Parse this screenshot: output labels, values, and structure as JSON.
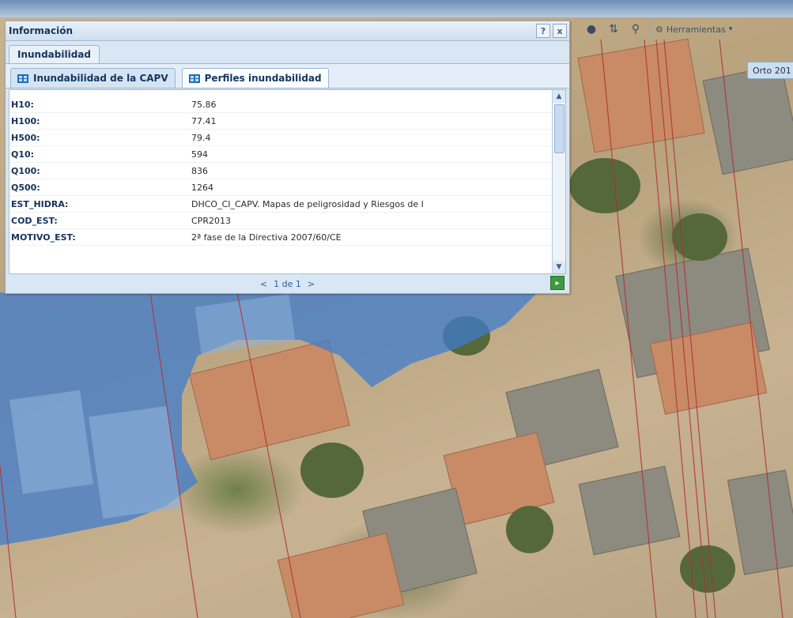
{
  "panel": {
    "title": "Información",
    "help_label": "?",
    "close_label": "x",
    "main_tab": "Inundabilidad",
    "sub_tabs": [
      {
        "label": "Inundabilidad de la CAPV",
        "active": false
      },
      {
        "label": "Perfiles inundabilidad",
        "active": true
      }
    ],
    "rows": [
      {
        "key": "H10:",
        "value": "75.86"
      },
      {
        "key": "H100:",
        "value": "77.41"
      },
      {
        "key": "H500:",
        "value": "79.4"
      },
      {
        "key": "Q10:",
        "value": "594"
      },
      {
        "key": "Q100:",
        "value": "836"
      },
      {
        "key": "Q500:",
        "value": "1264"
      },
      {
        "key": "EST_HIDRA:",
        "value": "DHCO_CI_CAPV. Mapas de peligrosidad y Riesgos de I"
      },
      {
        "key": "COD_EST:",
        "value": "CPR2013"
      },
      {
        "key": "MOTIVO_EST:",
        "value": "2ª fase de la Directiva 2007/60/CE"
      }
    ],
    "pager": {
      "prev": "<",
      "page_text": "1 de 1",
      "next": ">"
    }
  },
  "toolbar": {
    "tools_label": "Herramientas",
    "caret": "▾"
  },
  "map": {
    "layer_button": "Orto 201"
  },
  "colors": {
    "panel_bg": "#d9e6f3",
    "title_text": "#15355e",
    "flood_blue": "#4a7fc4"
  }
}
